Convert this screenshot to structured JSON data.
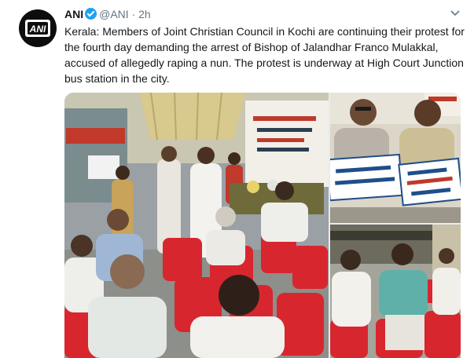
{
  "tweet": {
    "display_name": "ANI",
    "handle": "@ANI",
    "separator": "·",
    "time": "2h",
    "text": "Kerala: Members of Joint Christian Council in Kochi are continuing their protest for the fourth day demanding the arrest of Bishop of Jalandhar Franco Mulakkal, accused of allegedly raping a nun. The protest is underway at High Court Junction bus station in the city."
  },
  "avatar": {
    "logo_text": "ANI"
  },
  "colors": {
    "verified": "#1da1f2",
    "text_primary": "#14171a",
    "text_secondary": "#657786",
    "chair_red": "#d8262e"
  },
  "icons": {
    "verified": "verified-badge-icon",
    "caret": "chevron-down-icon"
  }
}
